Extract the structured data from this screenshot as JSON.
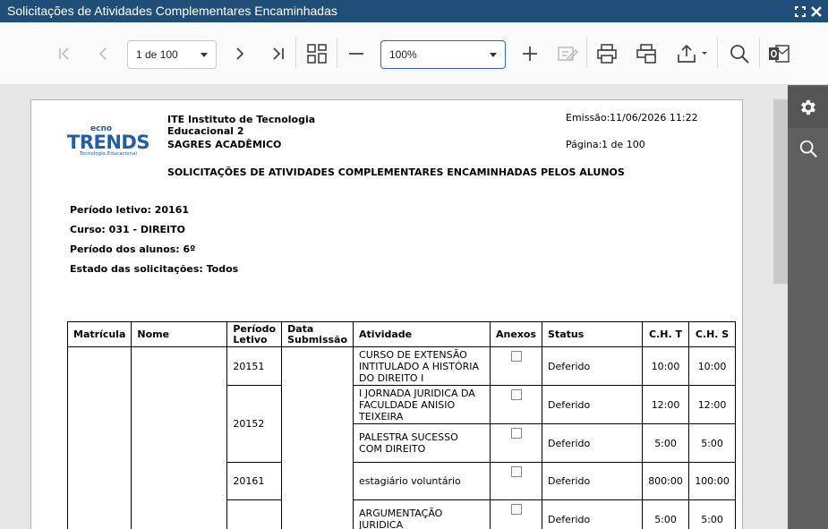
{
  "window": {
    "title": "Solicitações de Atividades Complementares Encaminhadas"
  },
  "toolbar": {
    "page_selector": "1 de 100",
    "zoom": "100%"
  },
  "report": {
    "logo_text": "Tecno TRENDS",
    "logo_subtitle": "Tecnologia Educacional",
    "institution_line1": "ITE Instituto de Tecnologia",
    "institution_line2": "Educacional 2",
    "system_name": "SAGRES ACADÊMICO",
    "emission_label": "Emissão:",
    "emission_value": "11/06/2026 11:22",
    "page_label": "Página:",
    "page_value": "1 de 100",
    "heading": "SOLICITAÇÕES DE ATIVIDADES COMPLEMENTARES ENCAMINHADAS PELOS ALUNOS",
    "filters": {
      "periodo_letivo": "Período letivo: 20161",
      "curso": "Curso: 031 - DIREITO",
      "periodo_alunos": "Período dos alunos: 6º",
      "estado": "Estado das solicitações: Todos"
    },
    "table": {
      "headers": {
        "matricula": "Matrícula",
        "nome": "Nome",
        "periodo_letivo_1": "Período",
        "periodo_letivo_2": "Letivo",
        "data_submissao_1": "Data",
        "data_submissao_2": "Submissão",
        "atividade": "Atividade",
        "anexos": "Anexos",
        "status": "Status",
        "cht": "C.H. T",
        "chs": "C.H. S"
      },
      "rows": [
        {
          "periodo": "20151",
          "atividade": "CURSO DE EXTENSÃO INTITULADO A HISTÓRIA DO DIREITO I",
          "status": "Deferido",
          "cht": "10:00",
          "chs": "10:00"
        },
        {
          "periodo": "20152",
          "atividade": "I JORNADA JURIDICA DA FACULDADE ANISIO TEIXEIRA",
          "status": "Deferido",
          "cht": "12:00",
          "chs": "12:00"
        },
        {
          "periodo": "",
          "atividade": "PALESTRA SUCESSO COM DIREITO",
          "status": "Deferido",
          "cht": "5:00",
          "chs": "5:00"
        },
        {
          "periodo": "20161",
          "atividade": "estagiário voluntário",
          "status": "Deferido",
          "cht": "800:00",
          "chs": "100:00"
        },
        {
          "periodo": "",
          "atividade": "ARGUMENTAÇÃO JURIDICA",
          "status": "Deferido",
          "cht": "5:00",
          "chs": "5:00"
        }
      ]
    }
  },
  "icons": {
    "first": "first-page-icon",
    "prev": "prev-page-icon",
    "next": "next-page-icon",
    "last": "last-page-icon",
    "multipage": "multipage-icon",
    "zoom_out": "zoom-out-icon",
    "zoom_in": "zoom-in-icon",
    "edit": "edit-icon",
    "print": "print-icon",
    "print_page": "print-page-icon",
    "export": "export-icon",
    "search": "search-icon",
    "outlook": "outlook-icon",
    "gear": "gear-icon",
    "fullscreen": "fullscreen-icon",
    "close": "close-icon"
  }
}
